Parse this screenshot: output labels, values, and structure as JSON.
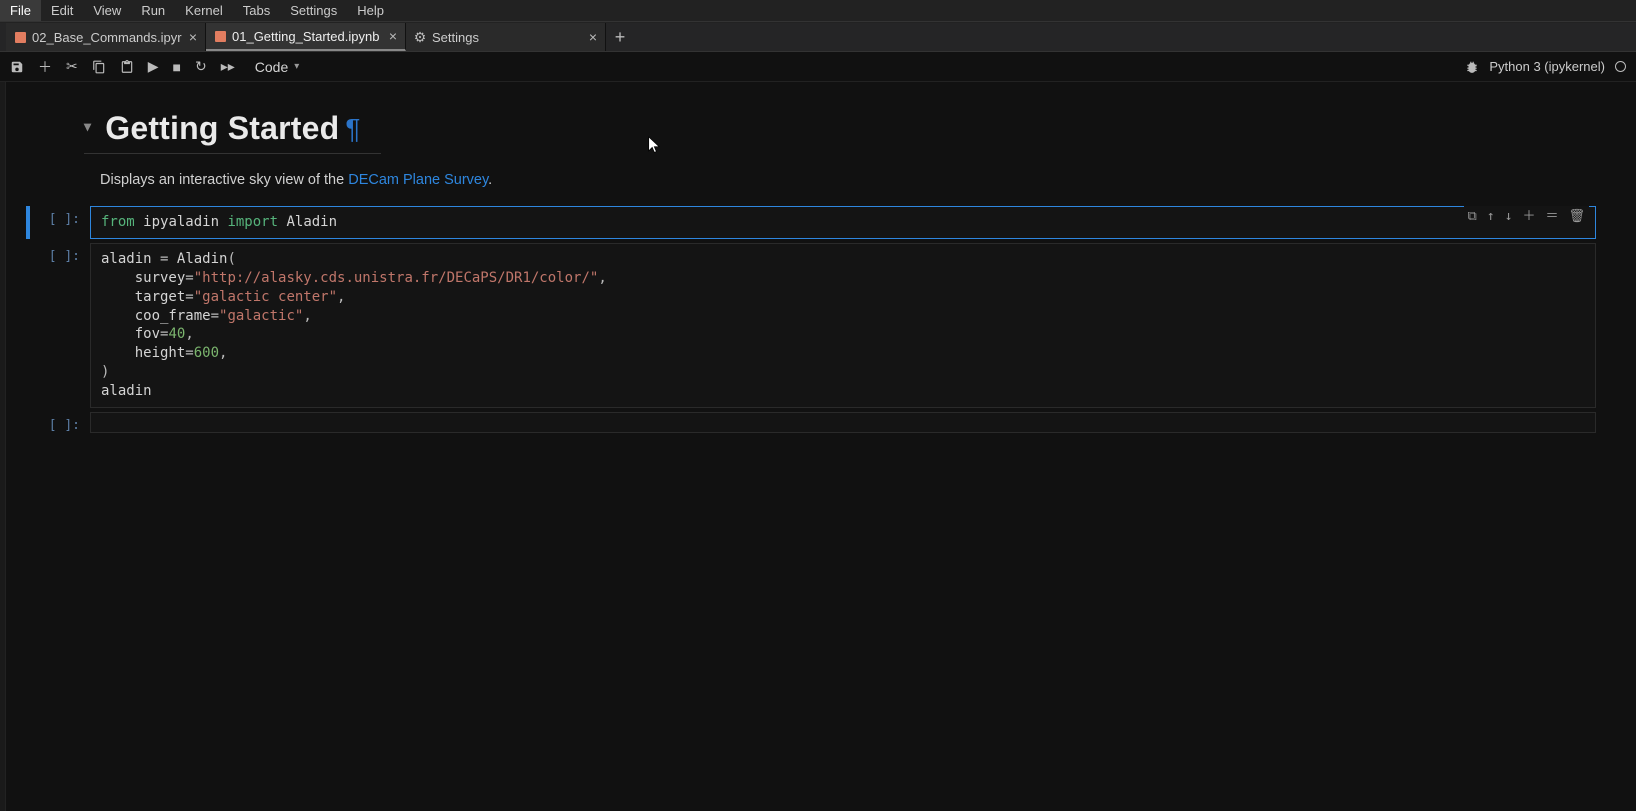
{
  "menu": {
    "items": [
      "File",
      "Edit",
      "View",
      "Run",
      "Kernel",
      "Tabs",
      "Settings",
      "Help"
    ],
    "active_index": 0
  },
  "tabs": {
    "items": [
      {
        "label": "02_Base_Commands.ipyr",
        "type": "notebook",
        "closable": true
      },
      {
        "label": "01_Getting_Started.ipynb",
        "type": "notebook",
        "closable": true,
        "active": true
      },
      {
        "label": "Settings",
        "type": "settings",
        "closable": true
      }
    ]
  },
  "toolbar": {
    "celltype": "Code",
    "kernel_name": "Python 3 (ipykernel)"
  },
  "notebook": {
    "heading": "Getting Started",
    "intro_prefix": "Displays an interactive sky view of the ",
    "intro_link_text": "DECam Plane Survey",
    "cells": [
      {
        "prompt": "[ ]:",
        "selected": true,
        "code_tokens": [
          [
            "key",
            "from"
          ],
          [
            "sp",
            " "
          ],
          [
            "id",
            "ipyaladin"
          ],
          [
            "sp",
            " "
          ],
          [
            "key",
            "import"
          ],
          [
            "sp",
            " "
          ],
          [
            "id",
            "Aladin"
          ]
        ]
      },
      {
        "prompt": "[ ]:",
        "code_lines": [
          [
            [
              "id",
              "aladin"
            ],
            [
              "sp",
              " "
            ],
            [
              "op",
              "="
            ],
            [
              "sp",
              " "
            ],
            [
              "id",
              "Aladin"
            ],
            [
              "op",
              "("
            ]
          ],
          [
            [
              "sp",
              "    "
            ],
            [
              "id",
              "survey"
            ],
            [
              "op",
              "="
            ],
            [
              "str",
              "\"http://alasky.cds.unistra.fr/DECaPS/DR1/color/\""
            ],
            [
              "op",
              ","
            ]
          ],
          [
            [
              "sp",
              "    "
            ],
            [
              "id",
              "target"
            ],
            [
              "op",
              "="
            ],
            [
              "str",
              "\"galactic center\""
            ],
            [
              "op",
              ","
            ]
          ],
          [
            [
              "sp",
              "    "
            ],
            [
              "id",
              "coo_frame"
            ],
            [
              "op",
              "="
            ],
            [
              "str",
              "\"galactic\""
            ],
            [
              "op",
              ","
            ]
          ],
          [
            [
              "sp",
              "    "
            ],
            [
              "id",
              "fov"
            ],
            [
              "op",
              "="
            ],
            [
              "num",
              "40"
            ],
            [
              "op",
              ","
            ]
          ],
          [
            [
              "sp",
              "    "
            ],
            [
              "id",
              "height"
            ],
            [
              "op",
              "="
            ],
            [
              "num",
              "600"
            ],
            [
              "op",
              ","
            ]
          ],
          [
            [
              "op",
              ")"
            ]
          ],
          [
            [
              "id",
              "aladin"
            ]
          ]
        ]
      },
      {
        "prompt": "[ ]:",
        "code_lines": [
          [
            [
              "sp",
              ""
            ]
          ]
        ]
      }
    ]
  }
}
